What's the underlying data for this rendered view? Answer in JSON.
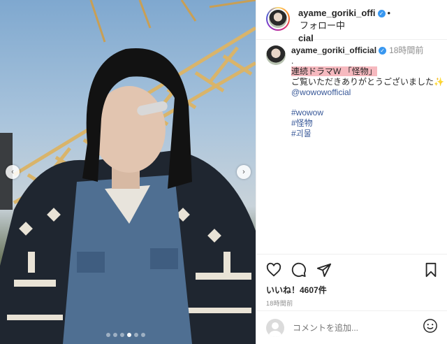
{
  "photo": {
    "nav_prev_icon": "chevron-left-icon",
    "nav_next_icon": "chevron-right-icon",
    "nav_prev_glyph": "‹",
    "nav_next_glyph": "›",
    "slide_count": 6,
    "active_slide": 4
  },
  "header": {
    "username_line1": "ayame_goriki_offi",
    "username_line2": "cial",
    "verified_glyph": "✓",
    "separator": "•",
    "follow_label": "フォロー中"
  },
  "caption": {
    "username": "ayame_goriki_official",
    "verified_glyph": "✓",
    "time": "18時間前",
    "line_dot": ".",
    "highlight_text": "連続ドラマW 「怪物」",
    "thanks_text": "ご覧いただきありがとうございました✨",
    "mention": "@wowowofficial",
    "hashtags": [
      "#wowow",
      "#怪物",
      "#괴물"
    ]
  },
  "actions": {
    "like_icon": "heart-icon",
    "comment_icon": "comment-icon",
    "share_icon": "send-icon",
    "save_icon": "bookmark-icon",
    "likes_text": "いいね！4607件",
    "posted_ago": "18時間前"
  },
  "comment": {
    "placeholder": "コメントを追加...",
    "emoji_icon": "smiley-icon"
  },
  "colors": {
    "verified": "#3897f0",
    "link": "#385898",
    "highlight": "#f6b9bf",
    "muted": "#8e8e8e"
  }
}
